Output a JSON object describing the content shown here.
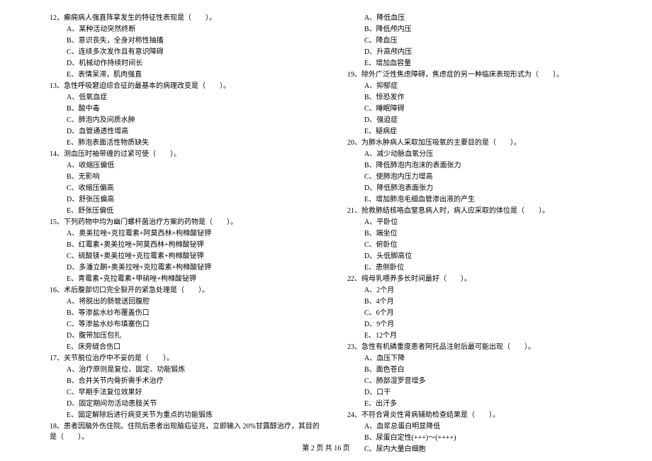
{
  "left": {
    "q12": {
      "stem": "12、癫痫病人强直阵挛发生的特征性表现是（　　）。",
      "A": "A、某种活动突然终断",
      "B": "B、意识丧失，全身对称性抽搐",
      "C": "C、连续多次发作且有意识障碍",
      "D": "D、机械动作持续时间长",
      "E": "E、表情呆滞，肌肉强直"
    },
    "q13": {
      "stem": "13、急性呼吸窘迫综合征的最基本的病理改变是（　　）。",
      "A": "A、低氧血症",
      "B": "B、酸中毒",
      "C": "C、肺泡内及间质水肿",
      "D": "D、血管通透性增高",
      "E": "E、肺泡表面活性物质缺失"
    },
    "q14": {
      "stem": "14、测血压时袖带缠的过紧可使（　　）。",
      "A": "A、收缩压偏低",
      "B": "B、无影响",
      "C": "C、收缩压偏高",
      "D": "D、舒张压偏高",
      "E": "E、舒张压偏低"
    },
    "q15": {
      "stem": "15、下列药物中均为幽门螺杆菌治疗方案的药物是（　　）。",
      "A": "A、奥美拉唑+克拉霉素+阿莫西林+枸橼酸铋钾",
      "B": "B、红霉素+奥美拉唑+阿莫西林+枸橼酸铋钾",
      "C": "C、硫酸镁+奥美拉唑+克拉霉素+枸橼酸铋钾",
      "D": "D、多潘立酮+奥美拉唑+克拉霉素+枸橼酸铋钾",
      "E": "E、青霉素+克拉霉素+甲硝唑+枸橼酸铋钾"
    },
    "q16": {
      "stem": "16、术后腹部切口完全裂开的紧急处理是（　　）。",
      "A": "A、将脱出的肠管送回腹腔",
      "B": "B、等渗盐水纱布覆盖伤口",
      "C": "C、等渗盐水纱布填塞伤口",
      "D": "D、腹带加压包扎",
      "E": "E、床旁缝合伤口"
    },
    "q17": {
      "stem": "17、关节脱位治疗中不妥的是（　　）。",
      "A": "A、治疗原则是复位、固定、功能锻炼",
      "B": "B、合并关节内骨折需手术治疗",
      "C": "C、早期手法复位效果好",
      "D": "D、固定期间勿活动患肢关节",
      "E": "E、固定解除后进行病变关节为重点的功能锻炼"
    },
    "q18": {
      "stem": "18、患者因脑外伤住院。住院后患者出现脑疝征兆，立即输入 20%甘露醇治疗，其目的是（　　）。"
    }
  },
  "right": {
    "q18opts": {
      "A": "A、降低血压",
      "B": "B、降低颅内压",
      "C": "C、降血压",
      "D": "D、升高颅内压",
      "E": "E、增加血容量"
    },
    "q19": {
      "stem": "19、除外广泛性焦虑障碍，焦虑症的另一种临床表现形式为（　　）。",
      "A": "A、抑郁症",
      "B": "B、惊恐发作",
      "C": "C、睡眠障碍",
      "D": "D、强迫症",
      "E": "E、疑病症"
    },
    "q20": {
      "stem": "20、为肺水肿病人采取加压吸氧的主要目的是（　　）。",
      "A": "A、减少动脉血氧分压",
      "B": "B、降低肺泡内泡沫的表面张力",
      "C": "C、使肺泡内压力增高",
      "D": "D、降低肺泡表面张力",
      "E": "E、增加肺泡毛细血管渗出液的产生"
    },
    "q21": {
      "stem": "21、抢救肺结核咯血窒息病人时，病人应采取的体位是（　　）。",
      "A": "A、平卧位",
      "B": "B、端坐位",
      "C": "C、俯卧位",
      "D": "D、头低脚高位",
      "E": "E、患侧卧位"
    },
    "q22": {
      "stem": "22、纯母乳喂养多长时间最好（　　）。",
      "A": "A、2个月",
      "B": "B、4个月",
      "C": "C、6个月",
      "D": "D、9个月",
      "E": "E、12个月"
    },
    "q23": {
      "stem": "23、急性有机磷重度患者阿托品注射后最可能出现（　　）。",
      "A": "A、血压下降",
      "B": "B、面色苍白",
      "C": "C、肺部湿罗音增多",
      "D": "D、口干",
      "E": "E、出汗多"
    },
    "q24": {
      "stem": "24、不符合肾炎性肾病辅助检查结果是（　　）。",
      "A": "A、血浆总蛋白明显降低",
      "B": "B、尿蛋白定性(+++)～(++++)",
      "C": "C、尿内大量白细胞"
    }
  },
  "footer": "第 2 页 共 16 页"
}
